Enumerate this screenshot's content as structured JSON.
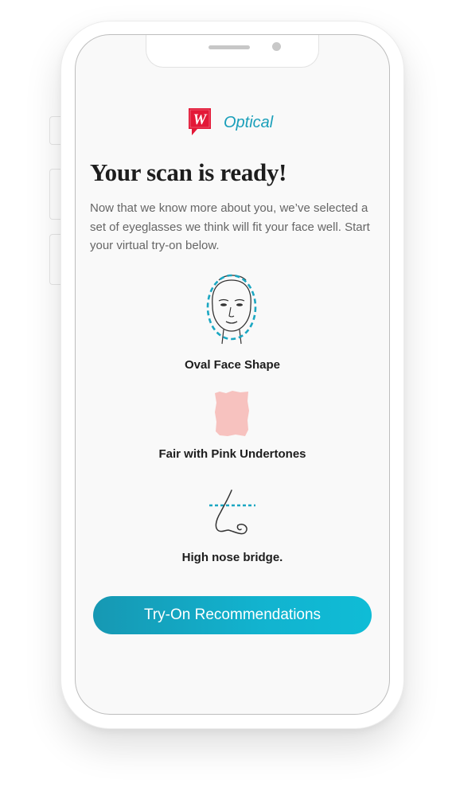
{
  "brand": {
    "name": "Optical",
    "logo_letter": "W",
    "accent_color": "#1a9fba",
    "logo_color": "#e31837"
  },
  "header": {
    "title": "Your scan is ready!"
  },
  "intro": {
    "text": "Now that we know more about you, we’ve selected a set of eyeglasses we think will fit your face well. Start your virtual try-on below."
  },
  "results": [
    {
      "icon": "face-outline-icon",
      "label": "Oval Face Shape"
    },
    {
      "icon": "skin-swatch-icon",
      "label": "Fair with Pink Undertones",
      "swatch_color": "#f7c2bf"
    },
    {
      "icon": "nose-profile-icon",
      "label": "High nose bridge."
    }
  ],
  "cta": {
    "label": "Try-On Recommendations",
    "colors": [
      "#1698b3",
      "#0fbcd6"
    ]
  }
}
